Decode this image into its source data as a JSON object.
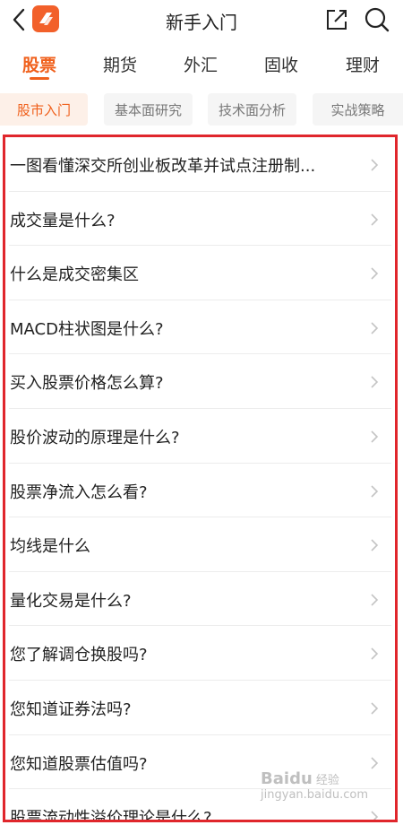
{
  "header": {
    "title": "新手入门"
  },
  "category_tabs": [
    {
      "label": "股票",
      "active": true
    },
    {
      "label": "期货",
      "active": false
    },
    {
      "label": "外汇",
      "active": false
    },
    {
      "label": "固收",
      "active": false
    },
    {
      "label": "理财",
      "active": false
    }
  ],
  "sub_tabs": [
    {
      "label": "股市入门",
      "active": true
    },
    {
      "label": "基本面研究",
      "active": false
    },
    {
      "label": "技术面分析",
      "active": false
    },
    {
      "label": "实战策略",
      "active": false
    }
  ],
  "articles": [
    "一图看懂深交所创业板改革并试点注册制...",
    "成交量是什么?",
    "什么是成交密集区",
    "MACD柱状图是什么?",
    "买入股票价格怎么算?",
    "股价波动的原理是什么?",
    "股票净流入怎么看?",
    "均线是什么",
    "量化交易是什么?",
    "您了解调仓换股吗?",
    "您知道证券法吗?",
    "您知道股票估值吗?",
    "股票流动性溢价理论是什么?"
  ],
  "watermark": {
    "brand": "Baidu",
    "sub": "经验",
    "url": "jingyan.baidu.com"
  },
  "colors": {
    "accent": "#f0601c",
    "frame": "#e0262c"
  }
}
